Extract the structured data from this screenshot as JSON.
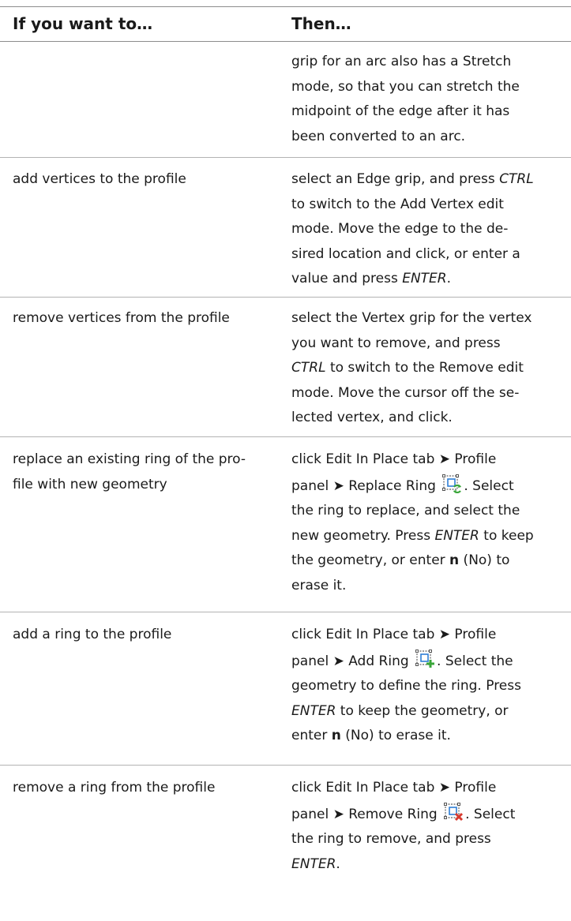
{
  "header": {
    "col1": "If you want to…",
    "col2": "Then…"
  },
  "rows": [
    {
      "action_lines": [],
      "then_lines": [
        "grip for an arc also has a Stretch",
        "mode, so that you can stretch the",
        "midpoint of the edge after it has",
        "been converted to an arc."
      ]
    },
    {
      "action_lines": [
        "add vertices to the profile"
      ],
      "then_lines": [
        "select an Edge grip, and press <i>CTRL</i>",
        "to switch to the Add Vertex edit",
        "mode. Move the edge to the de-",
        "sired location and click, or enter a",
        "value and press <i>ENTER</i>."
      ]
    },
    {
      "action_lines": [
        "remove vertices from the profile"
      ],
      "then_lines": [
        "select the Vertex grip for the vertex",
        "you want to remove, and press",
        "<i>CTRL</i> to switch to the Remove edit",
        "mode. Move the cursor off the se-",
        "lected vertex, and click."
      ]
    },
    {
      "action_lines": [
        "replace an existing ring of the pro-",
        "file with new geometry"
      ],
      "then_lines": [
        "click Edit In Place tab ➤ Profile",
        "panel ➤ Replace Ring {icon}. Select",
        "the ring to replace, and select the",
        "new geometry. Press <i>ENTER</i> to keep",
        "the geometry, or enter <b>n</b> (No) to",
        "erase it."
      ],
      "icon": "replace-ring-icon"
    },
    {
      "action_lines": [
        "add a ring to the profile"
      ],
      "then_lines": [
        "click Edit In Place tab ➤ Profile",
        "panel ➤ Add Ring {icon}. Select the",
        "geometry to define the ring. Press",
        "<i>ENTER</i> to keep the geometry, or",
        "enter <b>n</b> (No) to erase it."
      ],
      "icon": "add-ring-icon"
    },
    {
      "action_lines": [
        "remove a ring from the profile"
      ],
      "then_lines": [
        "click Edit In Place tab ➤ Profile",
        "panel ➤ Remove Ring {icon}. Select",
        "the ring to remove, and press",
        "<i>ENTER</i>."
      ],
      "icon": "remove-ring-icon"
    }
  ],
  "colors": {
    "rule": "#b3b3b3",
    "icon_blue": "#2f7fd6",
    "icon_green": "#3aa63a",
    "icon_red": "#d63a2f"
  }
}
